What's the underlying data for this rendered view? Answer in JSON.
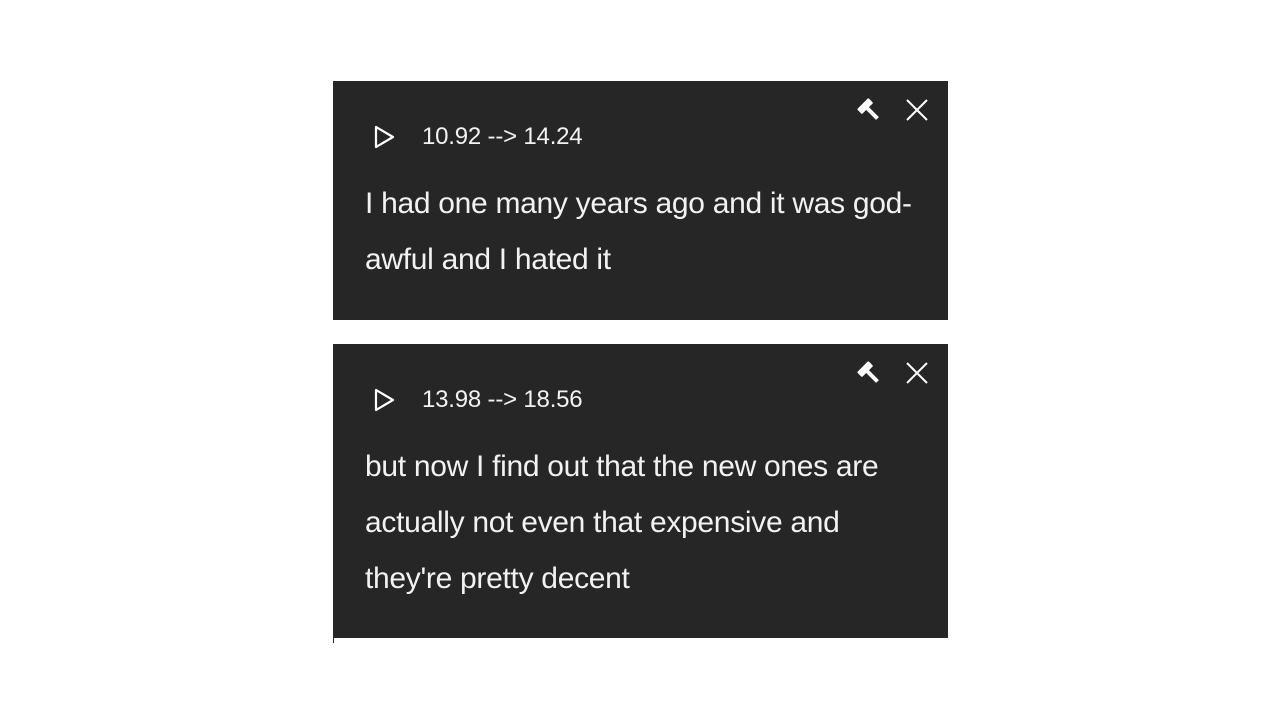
{
  "segments": [
    {
      "start": "10.92",
      "arrow": "-->",
      "end": "14.24",
      "timecode": "10.92 --> 14.24",
      "text": "I had one many years ago and it was god-awful and I hated it",
      "icons": {
        "play": "play-icon",
        "edit": "hammer-icon",
        "close": "close-icon"
      }
    },
    {
      "start": "13.98",
      "arrow": "-->",
      "end": "18.56",
      "timecode": "13.98 --> 18.56",
      "text": "but now I find out that the new ones are actually not even that expensive and they're pretty decent",
      "icons": {
        "play": "play-icon",
        "edit": "hammer-icon",
        "close": "close-icon"
      }
    }
  ],
  "colors": {
    "card_background": "#262626",
    "text": "#f2f2f2",
    "page_background": "#ffffff"
  }
}
